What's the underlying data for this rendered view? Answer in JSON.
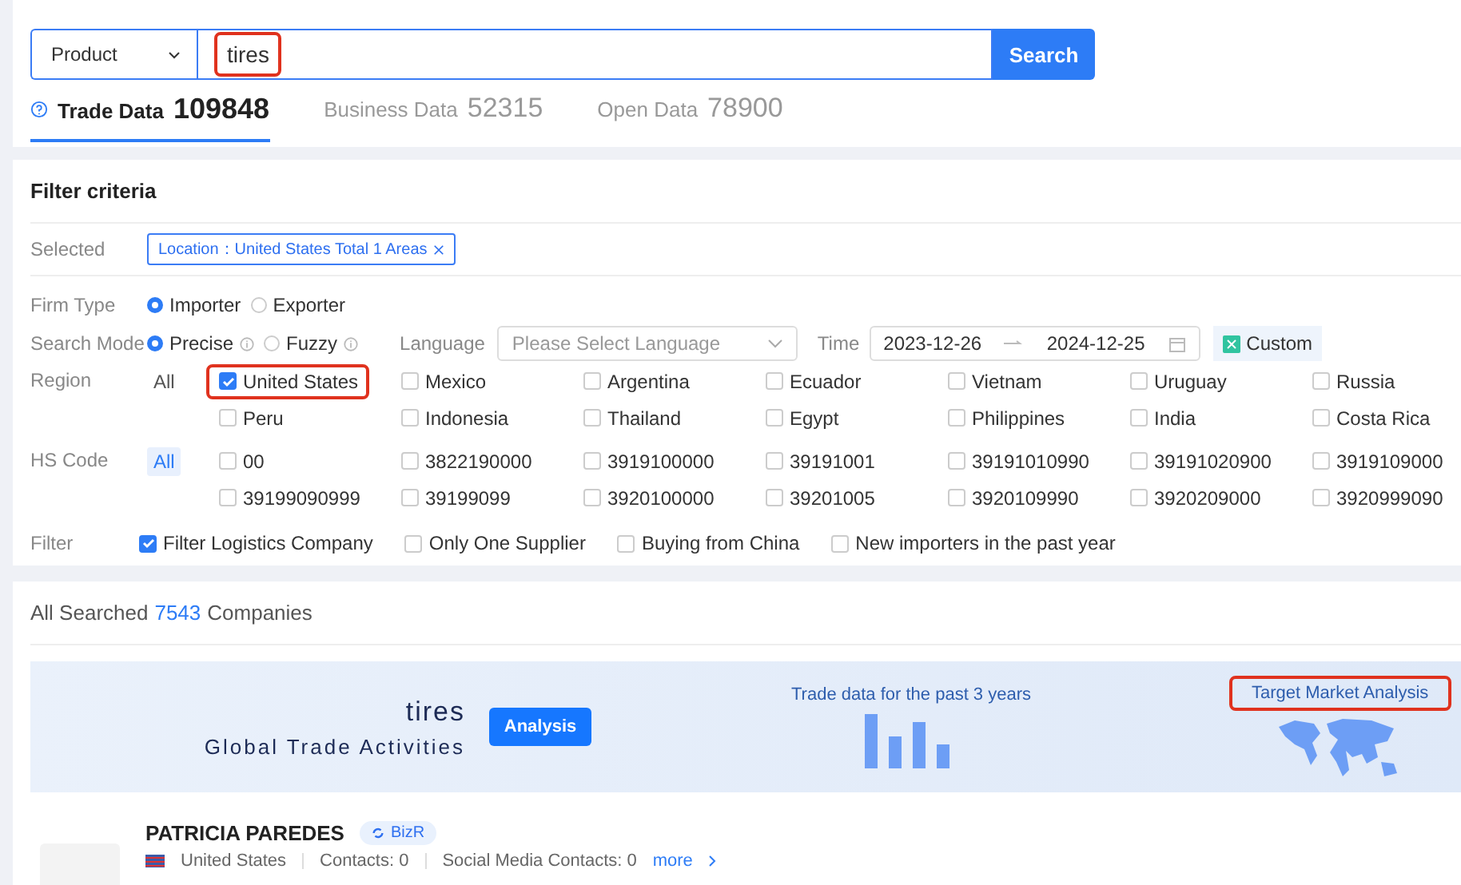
{
  "search": {
    "scope": "Product",
    "value": "tires",
    "highlighted": true,
    "button": "Search"
  },
  "data_tabs": [
    {
      "label": "Trade Data",
      "count": "109848",
      "selected": true
    },
    {
      "label": "Business Data",
      "count": "52315",
      "selected": false
    },
    {
      "label": "Open Data",
      "count": "78900",
      "selected": false
    }
  ],
  "filter": {
    "title": "Filter criteria",
    "selected_label": "Selected",
    "selected_tag": "Location：United States Total 1 Areas",
    "firm_type": {
      "label": "Firm Type",
      "options": [
        {
          "label": "Importer",
          "selected": true
        },
        {
          "label": "Exporter",
          "selected": false
        }
      ]
    },
    "search_mode": {
      "label": "Search Mode",
      "options": [
        {
          "label": "Precise",
          "selected": true
        },
        {
          "label": "Fuzzy",
          "selected": false
        }
      ]
    },
    "language": {
      "label": "Language",
      "placeholder": "Please Select Language"
    },
    "time": {
      "label": "Time",
      "start": "2023-12-26",
      "end": "2024-12-25"
    },
    "custom_button": "Custom",
    "region": {
      "label": "Region",
      "all": {
        "label": "All",
        "selected": false
      },
      "options": [
        {
          "label": "United States",
          "checked": true,
          "highlighted": true
        },
        {
          "label": "Mexico",
          "checked": false,
          "highlighted": false
        },
        {
          "label": "Argentina",
          "checked": false,
          "highlighted": false
        },
        {
          "label": "Ecuador",
          "checked": false,
          "highlighted": false
        },
        {
          "label": "Vietnam",
          "checked": false,
          "highlighted": false
        },
        {
          "label": "Uruguay",
          "checked": false,
          "highlighted": false
        },
        {
          "label": "Russia",
          "checked": false,
          "highlighted": false
        },
        {
          "label": "Peru",
          "checked": false,
          "highlighted": false
        },
        {
          "label": "Indonesia",
          "checked": false,
          "highlighted": false
        },
        {
          "label": "Thailand",
          "checked": false,
          "highlighted": false
        },
        {
          "label": "Egypt",
          "checked": false,
          "highlighted": false
        },
        {
          "label": "Philippines",
          "checked": false,
          "highlighted": false
        },
        {
          "label": "India",
          "checked": false,
          "highlighted": false
        },
        {
          "label": "Costa Rica",
          "checked": false,
          "highlighted": false
        }
      ]
    },
    "hs_code": {
      "label": "HS Code",
      "all": {
        "label": "All",
        "selected": true
      },
      "options": [
        {
          "label": "00",
          "checked": false,
          "highlighted": false
        },
        {
          "label": "3822190000",
          "checked": false,
          "highlighted": false
        },
        {
          "label": "3919100000",
          "checked": false,
          "highlighted": false
        },
        {
          "label": "39191001",
          "checked": false,
          "highlighted": false
        },
        {
          "label": "39191010990",
          "checked": false,
          "highlighted": false
        },
        {
          "label": "39191020900",
          "checked": false,
          "highlighted": false
        },
        {
          "label": "3919109000",
          "checked": false,
          "highlighted": false
        },
        {
          "label": "39199090999",
          "checked": false,
          "highlighted": false
        },
        {
          "label": "39199099",
          "checked": false,
          "highlighted": false
        },
        {
          "label": "3920100000",
          "checked": false,
          "highlighted": false
        },
        {
          "label": "39201005",
          "checked": false,
          "highlighted": false
        },
        {
          "label": "3920109990",
          "checked": false,
          "highlighted": false
        },
        {
          "label": "3920209000",
          "checked": false,
          "highlighted": false
        },
        {
          "label": "3920999090",
          "checked": false,
          "highlighted": false
        }
      ]
    },
    "filter_row": {
      "label": "Filter",
      "options": [
        {
          "label": "Filter Logistics Company",
          "checked": true
        },
        {
          "label": "Only One Supplier",
          "checked": false
        },
        {
          "label": "Buying from China",
          "checked": false
        },
        {
          "label": "New importers in the past year",
          "checked": false
        }
      ]
    }
  },
  "results": {
    "prefix": "All Searched",
    "count": "7543",
    "suffix": "Companies"
  },
  "banner": {
    "keyword": "tires",
    "subtitle": "Global Trade Activities",
    "button": "Analysis",
    "chart_caption": "Trade data for the past 3 years",
    "link": {
      "label": "Target Market Analysis",
      "highlighted": true
    }
  },
  "company": {
    "name": "PATRICIA PAREDES",
    "badge": "BizR",
    "country": "United States",
    "contacts": "Contacts: 0",
    "social": "Social Media Contacts: 0",
    "more": "more"
  }
}
